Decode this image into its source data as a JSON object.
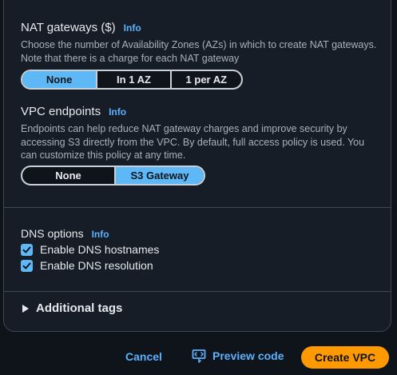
{
  "nat": {
    "heading": "NAT gateways ($)",
    "info": "Info",
    "description": "Choose the number of Availability Zones (AZs) in which to create NAT gateways. Note that there is a charge for each NAT gateway",
    "options": [
      "None",
      "In 1 AZ",
      "1 per AZ"
    ],
    "selected": "None"
  },
  "vpc_endpoints": {
    "heading": "VPC endpoints",
    "info": "Info",
    "description": "Endpoints can help reduce NAT gateway charges and improve security by accessing S3 directly from the VPC. By default, full access policy is used. You can customize this policy at any time.",
    "options": [
      "None",
      "S3 Gateway"
    ],
    "selected": "S3 Gateway"
  },
  "dns": {
    "heading": "DNS options",
    "info": "Info",
    "hostnames_label": "Enable DNS hostnames",
    "hostnames_checked": true,
    "resolution_label": "Enable DNS resolution",
    "resolution_checked": true
  },
  "additional_tags": {
    "label": "Additional tags",
    "expanded": false
  },
  "footer": {
    "cancel": "Cancel",
    "preview": "Preview code",
    "create": "Create VPC"
  },
  "colors": {
    "accent": "#5eb8f5",
    "link": "#5cb1ff",
    "primary_button": "#ff9900",
    "background": "#0f141a",
    "panel": "#161d26"
  }
}
